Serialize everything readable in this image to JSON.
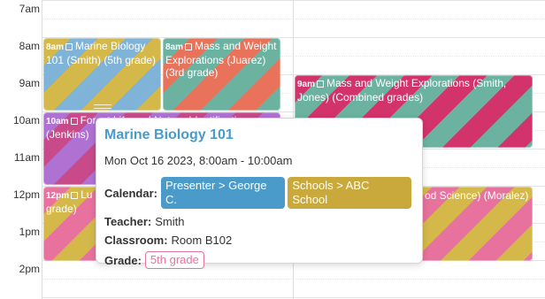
{
  "time_labels": [
    "7am",
    "8am",
    "9am",
    "10am",
    "11am",
    "12pm",
    "1pm",
    "2pm"
  ],
  "events": {
    "marine": {
      "time": "8am",
      "title": "Marine Biology 101 (Smith) (5th grade)"
    },
    "mass_juarez": {
      "time": "8am",
      "title": "Mass and Weight Explorations (Juarez) (3rd grade)"
    },
    "mass_smith": {
      "time": "9am",
      "title": "Mass and Weight Explorations (Smith, Jones) (Combined grades)"
    },
    "forest": {
      "time": "10am",
      "title": "Forest Life and Nature Identification (Jenkins)"
    },
    "lu": {
      "time": "12pm",
      "title": "Lu",
      "extra": "grade)"
    },
    "food": {
      "title": "od Science) (Moralez)"
    }
  },
  "popover": {
    "title": "Marine Biology 101",
    "datetime": "Mon Oct 16 2023, 8:00am - 10:00am",
    "calendar_label": "Calendar:",
    "calendar_chips": [
      "Presenter > George C.",
      "Schools > ABC School"
    ],
    "teacher_label": "Teacher:",
    "teacher": "Smith",
    "classroom_label": "Classroom:",
    "classroom": "Room B102",
    "grade_label": "Grade:",
    "grade": "5th grade"
  },
  "colors": {
    "popover_title": "#4a9bc9",
    "chip_presenter": "#4a9bc9",
    "chip_school": "#c9a93c",
    "grade_chip": "#e8729e"
  }
}
